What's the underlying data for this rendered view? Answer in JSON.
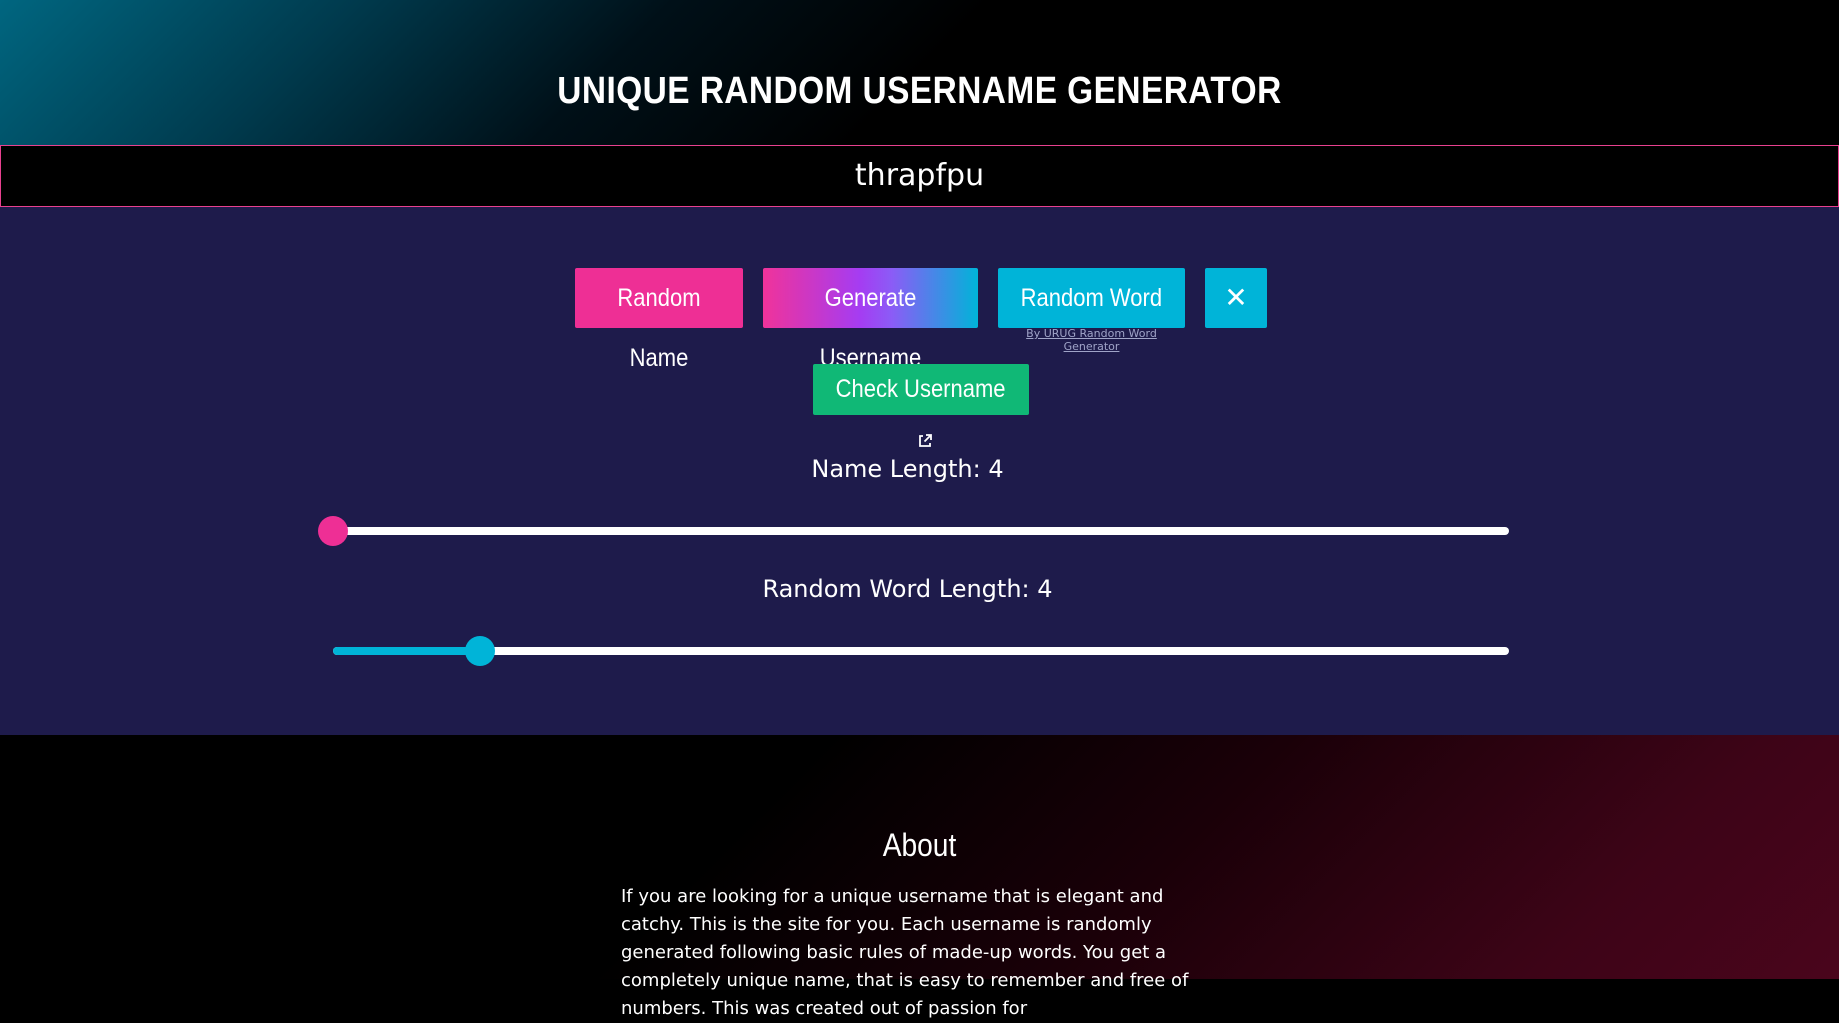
{
  "header": {
    "title": "UNIQUE RANDOM USERNAME GENERATOR"
  },
  "output": {
    "value": "thrapfpu"
  },
  "buttons": {
    "random_name": "Random Name",
    "generate_username": "Generate Username",
    "random_word": "Random Word",
    "close": "✕",
    "credit": "By URUG Random Word Generator",
    "check_username": "Check Username"
  },
  "sliders": {
    "name_length": {
      "label": "Name Length:",
      "value": "4",
      "fraction": 0.0,
      "color": "#ee2f95"
    },
    "word_length": {
      "label": "Random Word Length:",
      "value": "4",
      "fraction": 0.125,
      "color": "#00b4d8"
    }
  },
  "about": {
    "title": "About",
    "text": "If you are looking for a unique username that is elegant and catchy. This is the site for you. Each username is randomly generated following basic rules of made-up words. You get a completely unique name, that is easy to remember and free of numbers. This was created out of passion for"
  },
  "colors": {
    "accent_pink": "#ee2f95",
    "accent_cyan": "#00b4d8",
    "accent_green": "#10b876",
    "panel_bg": "#1e1b4b"
  }
}
